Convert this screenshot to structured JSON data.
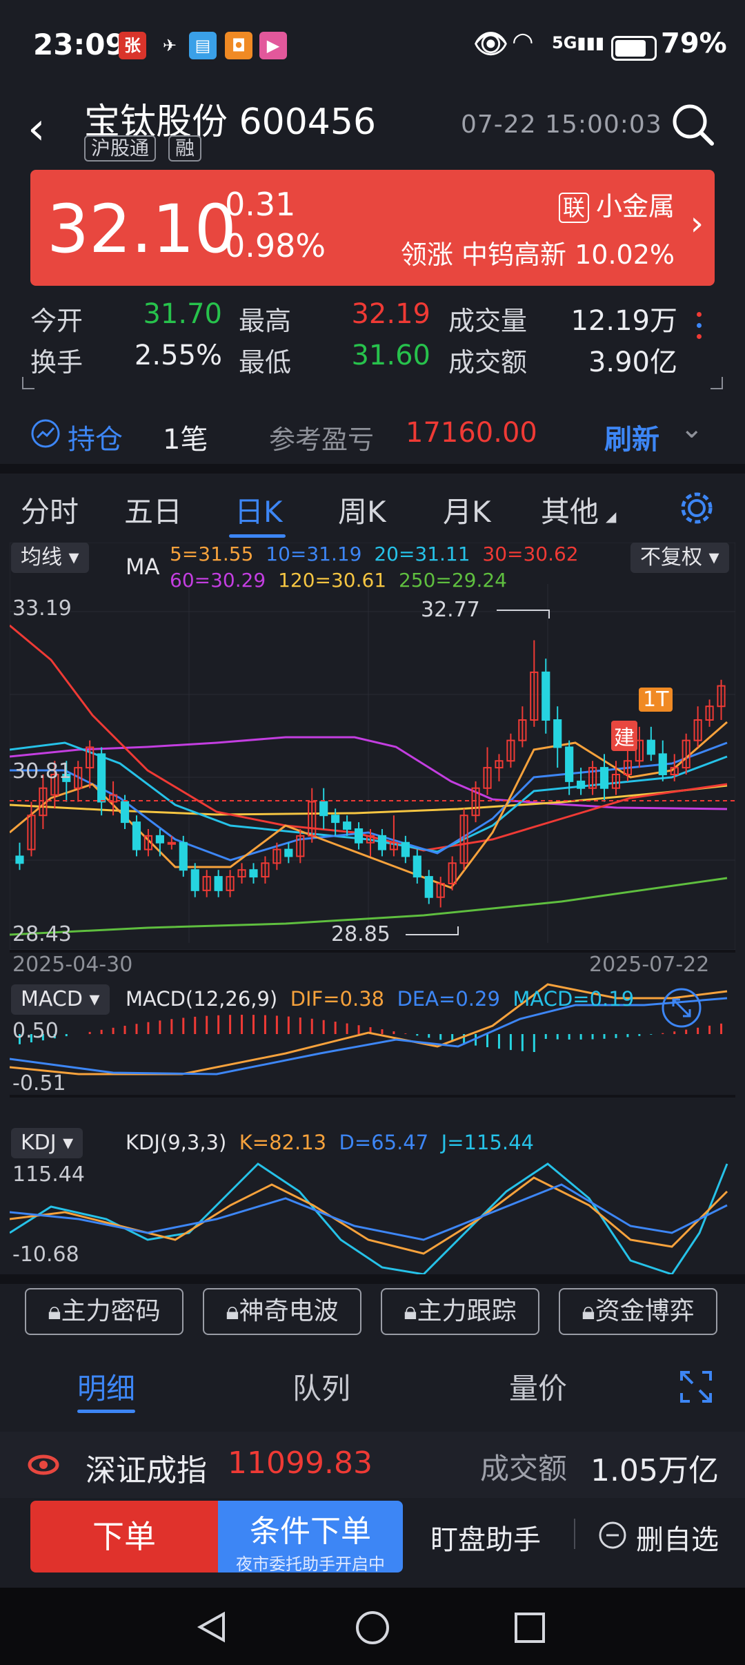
{
  "status_bar": {
    "time": "23:09",
    "battery": "79%",
    "network": "5G"
  },
  "header": {
    "stock_name": "宝钛股份",
    "stock_code": "600456",
    "tag1": "沪股通",
    "tag2": "融",
    "datetime": "07-22 15:00:03"
  },
  "price": {
    "last": "32.10",
    "change": "0.31",
    "change_pct": "0.98%",
    "sector_tag": "联",
    "sector": "小金属",
    "lead_label": "领涨",
    "lead_stock": "中钨高新",
    "lead_pct": "10.02%"
  },
  "stats": {
    "open_label": "今开",
    "open": "31.70",
    "high_label": "最高",
    "high": "32.19",
    "volume_label": "成交量",
    "volume": "12.19万",
    "turnover_label": "换手",
    "turnover": "2.55%",
    "low_label": "最低",
    "low": "31.60",
    "amount_label": "成交额",
    "amount": "3.90亿"
  },
  "position": {
    "label": "持仓",
    "count": "1笔",
    "pnl_label": "参考盈亏",
    "pnl": "17160.00",
    "refresh": "刷新"
  },
  "tabs": [
    "分时",
    "五日",
    "日K",
    "周K",
    "月K",
    "其他"
  ],
  "kline": {
    "ma_dropdown": "均线",
    "ma_label": "MA",
    "adjust": "不复权",
    "ma_values": {
      "ma5": "5=31.55",
      "ma10": "10=31.19",
      "ma20": "20=31.11",
      "ma30": "30=30.62",
      "ma60": "60=30.29",
      "ma120": "120=30.61",
      "ma250": "250=29.24"
    },
    "y_top": "33.19",
    "y_mid": "30.81",
    "y_bottom": "28.43",
    "max_label": "32.77",
    "min_label": "28.85",
    "date_start": "2025-04-30",
    "date_end": "2025-07-22",
    "marker_jian": "建",
    "marker_t": "1T"
  },
  "macd": {
    "dropdown": "MACD",
    "params": "MACD(12,26,9)",
    "dif": "DIF=0.38",
    "dea": "DEA=0.29",
    "macd": "MACD=0.19",
    "y_top": "0.50",
    "y_bottom": "-0.51"
  },
  "kdj": {
    "dropdown": "KDJ",
    "params": "KDJ(9,3,3)",
    "k": "K=82.13",
    "d": "D=65.47",
    "j": "J=115.44",
    "y_top": "115.44",
    "y_bottom": "-10.68"
  },
  "feature_buttons": [
    "主力密码",
    "神奇电波",
    "主力跟踪",
    "资金博弈"
  ],
  "bottom_tabs": [
    "明细",
    "队列",
    "量价"
  ],
  "index_bar": {
    "name": "深证成指",
    "value": "11099.83",
    "amount_label": "成交额",
    "amount": "1.05万亿"
  },
  "actions": {
    "order": "下单",
    "conditional": "条件下单",
    "conditional_sub": "夜市委托助手开启中",
    "assistant": "盯盘助手",
    "remove": "删自选"
  },
  "colors": {
    "up": "#ef3a35",
    "down": "#26d4e0",
    "ma5": "#f7a23c",
    "ma10": "#3d86f5",
    "ma20": "#26c2e8",
    "ma30": "#ef3a35",
    "ma60": "#c33ee0",
    "ma120": "#f5c542",
    "ma250": "#5fbf3f",
    "accent": "#3d86f5"
  }
}
